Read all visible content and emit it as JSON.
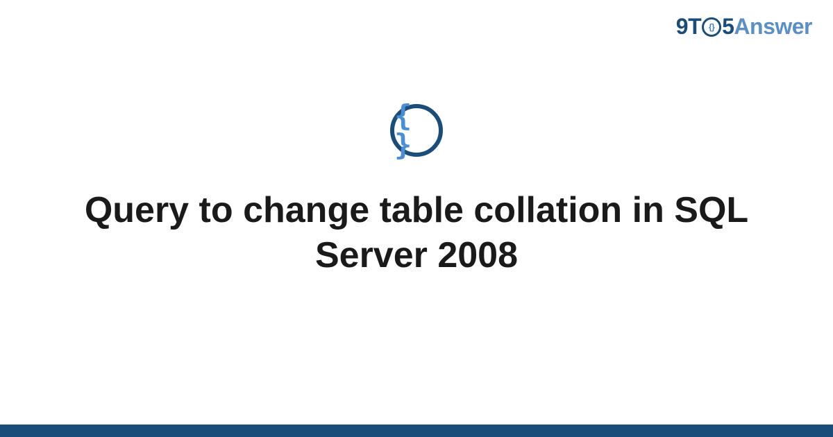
{
  "logo": {
    "part1": "9T",
    "clock_inner": "{}",
    "part2": "5",
    "part3": "Answer"
  },
  "icon": {
    "braces": "{ }"
  },
  "title": "Query to change table collation in SQL Server 2008",
  "colors": {
    "brand_dark": "#1a4d7a",
    "brand_light": "#5a8fc7",
    "accent": "#4a8fd6"
  }
}
